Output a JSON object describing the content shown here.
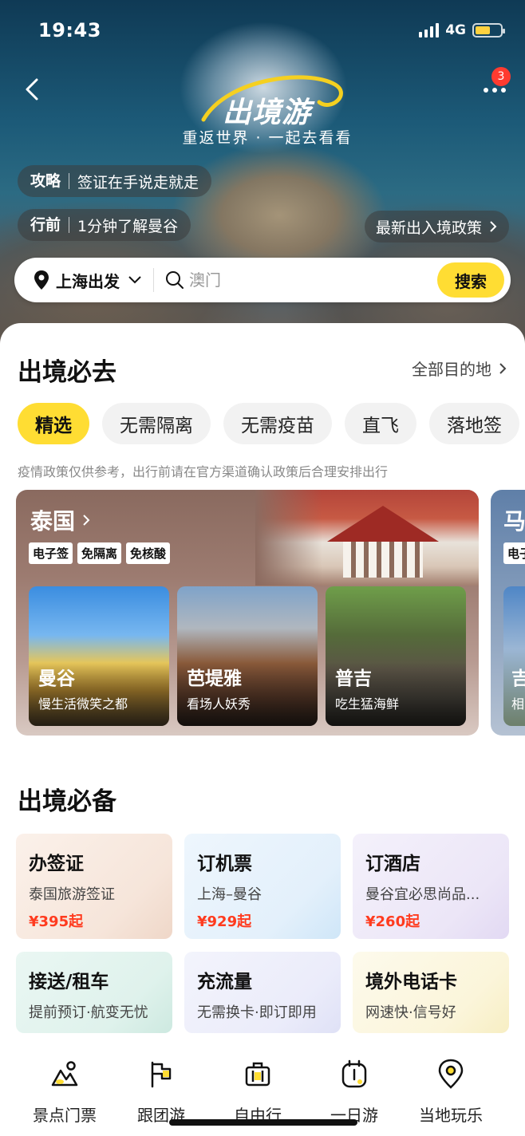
{
  "status_bar": {
    "time": "19:43",
    "network": "4G"
  },
  "hero": {
    "brand_title": "出境游",
    "brand_subtitle": "重返世界 · 一起去看看",
    "more_badge_count": "3",
    "pills": [
      {
        "key": "攻略",
        "text": "签证在手说走就走"
      },
      {
        "key": "行前",
        "text": "1分钟了解曼谷"
      }
    ],
    "policy_link": "最新出入境政策"
  },
  "search": {
    "location": "上海出发",
    "placeholder": "澳门",
    "button": "搜索"
  },
  "must_go": {
    "title": "出境必去",
    "link": "全部目的地",
    "tabs": [
      {
        "label": "精选",
        "active": true
      },
      {
        "label": "无需隔离",
        "active": false
      },
      {
        "label": "无需疫苗",
        "active": false
      },
      {
        "label": "直飞",
        "active": false
      },
      {
        "label": "落地签",
        "active": false
      }
    ],
    "notice": "疫情政策仅供参考，出行前请在官方渠道确认政策后合理安排出行",
    "country": {
      "name": "泰国",
      "tags": [
        "电子签",
        "免隔离",
        "免核酸"
      ],
      "cities": [
        {
          "name": "曼谷",
          "desc": "慢生活微笑之都"
        },
        {
          "name": "芭堤雅",
          "desc": "看场人妖秀"
        },
        {
          "name": "普吉",
          "desc": "吃生猛海鲜"
        }
      ]
    },
    "next_country": {
      "name": "马",
      "tag": "电子",
      "city_name": "吉",
      "city_desc": "相"
    }
  },
  "essentials": {
    "title": "出境必备",
    "items": [
      {
        "title": "办签证",
        "sub": "泰国旅游签证",
        "price": "¥395起"
      },
      {
        "title": "订机票",
        "sub": "上海–曼谷",
        "price": "¥929起"
      },
      {
        "title": "订酒店",
        "sub": "曼谷宜必思尚品...",
        "price": "¥260起"
      },
      {
        "title": "接送/租车",
        "sub": "提前预订·航变无忧"
      },
      {
        "title": "充流量",
        "sub": "无需换卡·即订即用"
      },
      {
        "title": "境外电话卡",
        "sub": "网速快·信号好"
      }
    ]
  },
  "bottom_nav": [
    {
      "label": "景点门票",
      "icon": "mountain-ticket-icon"
    },
    {
      "label": "跟团游",
      "icon": "flag-icon"
    },
    {
      "label": "自由行",
      "icon": "suitcase-icon"
    },
    {
      "label": "一日游",
      "icon": "clock-icon"
    },
    {
      "label": "当地玩乐",
      "icon": "location-pin-icon"
    }
  ],
  "colors": {
    "accent": "#ffdd33",
    "price": "#ff3b1f",
    "badge": "#ff3b30"
  }
}
